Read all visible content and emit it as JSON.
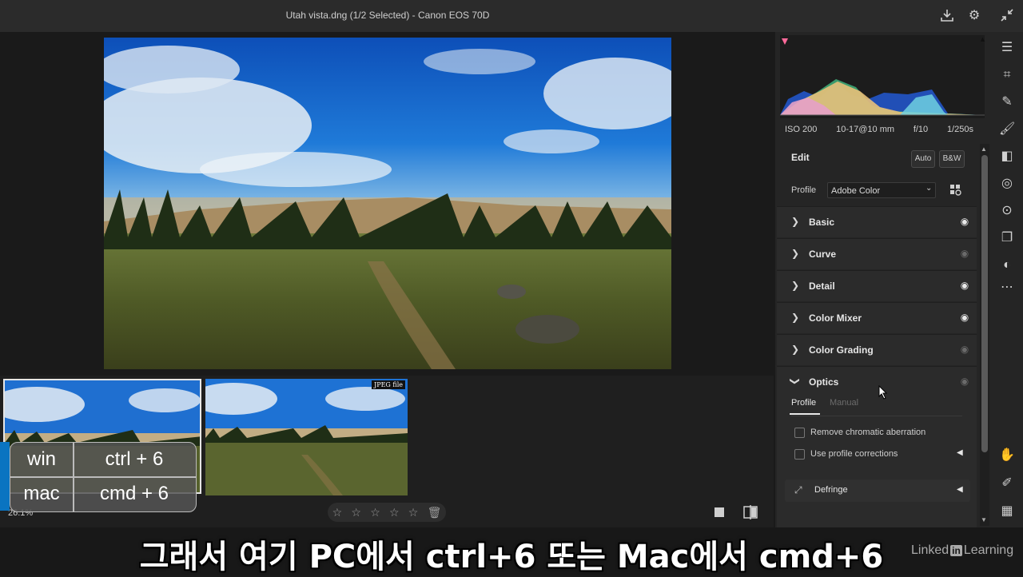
{
  "window": {
    "title": "Utah vista.dng (1/2 Selected)  -  Canon EOS 70D"
  },
  "titlebar_icons": [
    "download-icon",
    "gear-icon",
    "collapse-icon"
  ],
  "filmstrip": {
    "badge": "JPEG file"
  },
  "bottombar": {
    "zoom": "26.1%",
    "stars": [
      "☆",
      "☆",
      "☆",
      "☆",
      "☆"
    ]
  },
  "shortcut": {
    "rows": [
      {
        "platform": "win",
        "keys": "ctrl + 6"
      },
      {
        "platform": "mac",
        "keys": "cmd + 6"
      }
    ],
    "accent": "#0a74c1"
  },
  "exif": {
    "iso": "ISO 200",
    "lens": "10-17@10 mm",
    "aperture": "f/10",
    "shutter": "1/250s"
  },
  "edit": {
    "title": "Edit",
    "auto": "Auto",
    "bw": "B&W",
    "profile_label": "Profile",
    "profile_value": "Adobe Color"
  },
  "sections": [
    {
      "label": "Basic",
      "visible": true
    },
    {
      "label": "Curve",
      "visible": false
    },
    {
      "label": "Detail",
      "visible": true
    },
    {
      "label": "Color Mixer",
      "visible": true
    },
    {
      "label": "Color Grading",
      "visible": false
    },
    {
      "label": "Optics",
      "visible": false,
      "expanded": true
    }
  ],
  "optics": {
    "tabs": [
      "Profile",
      "Manual"
    ],
    "active_tab": "Profile",
    "checkboxes": [
      "Remove chromatic aberration",
      "Use profile corrections"
    ],
    "defringe": "Defringe"
  },
  "caption": "그래서 여기 PC에서 ctrl+6 또는 Mac에서 cmd+6",
  "brand": {
    "pre": "Linked",
    "in": "in",
    "post": "Learning"
  },
  "colors": {
    "panel": "#252525",
    "section": "#2b2b2b",
    "accent": "#0a74c1"
  }
}
